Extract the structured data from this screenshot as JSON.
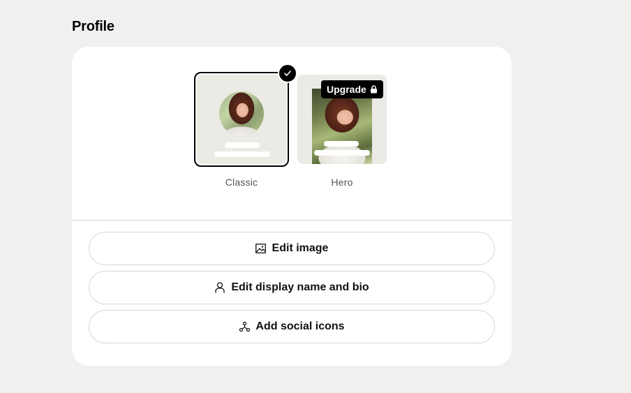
{
  "section": {
    "title": "Profile"
  },
  "layouts": {
    "classic": {
      "label": "Classic",
      "selected": true
    },
    "hero": {
      "label": "Hero",
      "badge": "Upgrade",
      "locked": true
    }
  },
  "actions": {
    "edit_image": "Edit image",
    "edit_name_bio": "Edit display name and bio",
    "add_social": "Add social icons"
  },
  "colors": {
    "background": "#f1f0ee",
    "card": "#ffffff",
    "thumb_bg": "#ebeae5",
    "accent": "#000000"
  }
}
